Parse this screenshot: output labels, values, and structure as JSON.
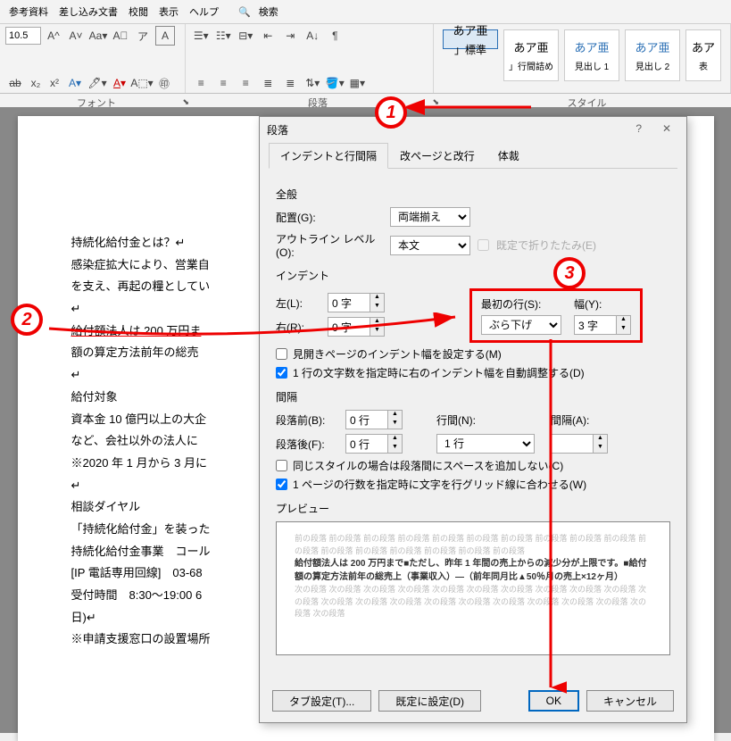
{
  "menubar": [
    "参考資料",
    "差し込み文書",
    "校閲",
    "表示",
    "ヘルプ"
  ],
  "search_placeholder": "検索",
  "ribbon": {
    "font_size": "10.5",
    "group_font": "フォント",
    "group_para": "段落",
    "group_style": "スタイル"
  },
  "styles": [
    {
      "preview": "あア亜",
      "name": "」標準"
    },
    {
      "preview": "あア亜",
      "name": "」行間詰め"
    },
    {
      "preview": "あア亜",
      "name": "見出し 1"
    },
    {
      "preview": "あア亜",
      "name": "見出し 2"
    },
    {
      "preview": "あア",
      "name": "表"
    }
  ],
  "doc_lines": [
    "持続化給付金とは？↵",
    "感染症拡大により、営業自",
    "を支え、再起の糧としてい",
    "↵",
    "給付額法人は 200 万円ま",
    "額の算定方法前年の総売",
    "↵",
    "給付対象",
    "資本金 10 億円以上の大企",
    "など、会社以外の法人に",
    "※2020 年 1 月から 3 月に",
    "↵",
    "相談ダイヤル",
    "「持続化給付金」を装った",
    "持続化給付金事業　コール",
    "[IP 電話専用回線]　03-68",
    "受付時間　8:30～19:00 6",
    "日)↵",
    "※申請支援窓口の設置場所"
  ],
  "dialog": {
    "title": "段落",
    "tabs": [
      "インデントと行間隔",
      "改ページと改行",
      "体裁"
    ],
    "section_general": "全般",
    "align_label": "配置(G):",
    "align_value": "両端揃え",
    "outline_label": "アウトライン レベル(O):",
    "outline_value": "本文",
    "collapse_label": "既定で折りたたみ(E)",
    "section_indent": "インデント",
    "left_label": "左(L):",
    "left_value": "0 字",
    "right_label": "右(R):",
    "right_value": "0 字",
    "firstline_label": "最初の行(S):",
    "firstline_value": "ぶら下げ",
    "width_label": "幅(Y):",
    "width_value": "3 字",
    "mirror_label": "見開きページのインデント幅を設定する(M)",
    "autowidth_label": "1 行の文字数を指定時に右のインデント幅を自動調整する(D)",
    "section_spacing": "間隔",
    "before_label": "段落前(B):",
    "before_value": "0 行",
    "after_label": "段落後(F):",
    "after_value": "0 行",
    "linesp_label": "行間(N):",
    "linesp_value": "1 行",
    "at_label": "間隔(A):",
    "at_value": "",
    "nospace_label": "同じスタイルの場合は段落間にスペースを追加しない(C)",
    "grid_label": "1 ページの行数を指定時に文字を行グリッド線に合わせる(W)",
    "section_preview": "プレビュー",
    "preview_gray": "前の段落 前の段落 前の段落 前の段落 前の段落 前の段落 前の段落 前の段落 前の段落 前の段落 前の段落 前の段落 前の段落 前の段落 前の段落 前の段落 前の段落",
    "preview_text": "給付額法人は 200 万円まで■ただし、昨年 1 年間の売上からの減少分が上限です。■給付額の算定方法前年の総売上（事業収入）―（前年同月比▲50％月の売上×12ヶ月）",
    "preview_gray2": "次の段落 次の段落 次の段落 次の段落 次の段落 次の段落 次の段落 次の段落 次の段落 次の段落 次の段落 次の段落 次の段落 次の段落 次の段落 次の段落 次の段落 次の段落 次の段落 次の段落 次の段落 次の段落",
    "btn_tabs": "タブ設定(T)...",
    "btn_default": "既定に設定(D)",
    "btn_ok": "OK",
    "btn_cancel": "キャンセル"
  },
  "annotations": {
    "c1": "1",
    "c2": "2",
    "c3": "3"
  }
}
